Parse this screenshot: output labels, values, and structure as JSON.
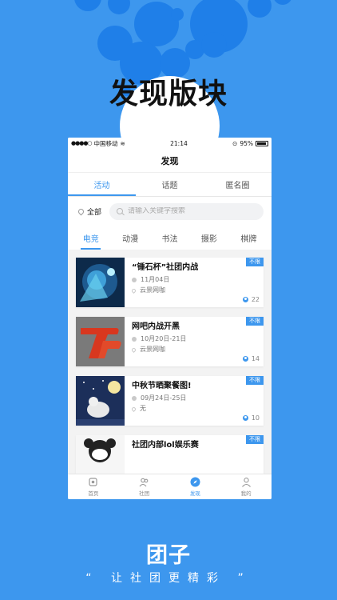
{
  "headline": "发现版块",
  "status_bar": {
    "carrier": "中国移动",
    "time": "21:14",
    "battery": "95%",
    "battery_level": 0.95
  },
  "nav": {
    "title": "发现"
  },
  "tabs": [
    {
      "label": "活动",
      "active": true
    },
    {
      "label": "话题",
      "active": false
    },
    {
      "label": "匿名圈",
      "active": false
    }
  ],
  "location": {
    "label": "全部"
  },
  "search": {
    "placeholder": "请输入关键字搜索"
  },
  "categories": [
    {
      "label": "电竞",
      "active": true
    },
    {
      "label": "动漫",
      "active": false
    },
    {
      "label": "书法",
      "active": false
    },
    {
      "label": "摄影",
      "active": false
    },
    {
      "label": "棋牌",
      "active": false
    }
  ],
  "events": [
    {
      "title": "“锤石杯”社团内战",
      "date": "11月04日",
      "place": "云景网咖",
      "badge": "不限",
      "count": "22"
    },
    {
      "title": "网吧内战开黑",
      "date": "10月20日-21日",
      "place": "云景网咖",
      "badge": "不限",
      "count": "14"
    },
    {
      "title": "中秋节晒聚餐图!",
      "date": "09月24日-25日",
      "place": "无",
      "badge": "不限",
      "count": "10"
    },
    {
      "title": "社团内部lol娱乐赛",
      "badge": "不限"
    }
  ],
  "tabbar": [
    {
      "label": "首页",
      "icon": "home-icon",
      "active": false
    },
    {
      "label": "社团",
      "icon": "group-icon",
      "active": false
    },
    {
      "label": "发现",
      "icon": "compass-icon",
      "active": true
    },
    {
      "label": "我的",
      "icon": "profile-icon",
      "active": false
    }
  ],
  "brand": {
    "name": "团子",
    "slogan": "“ 让社团更精彩 ”"
  },
  "colors": {
    "accent": "#3d97ee",
    "background": "#3d97ee"
  }
}
